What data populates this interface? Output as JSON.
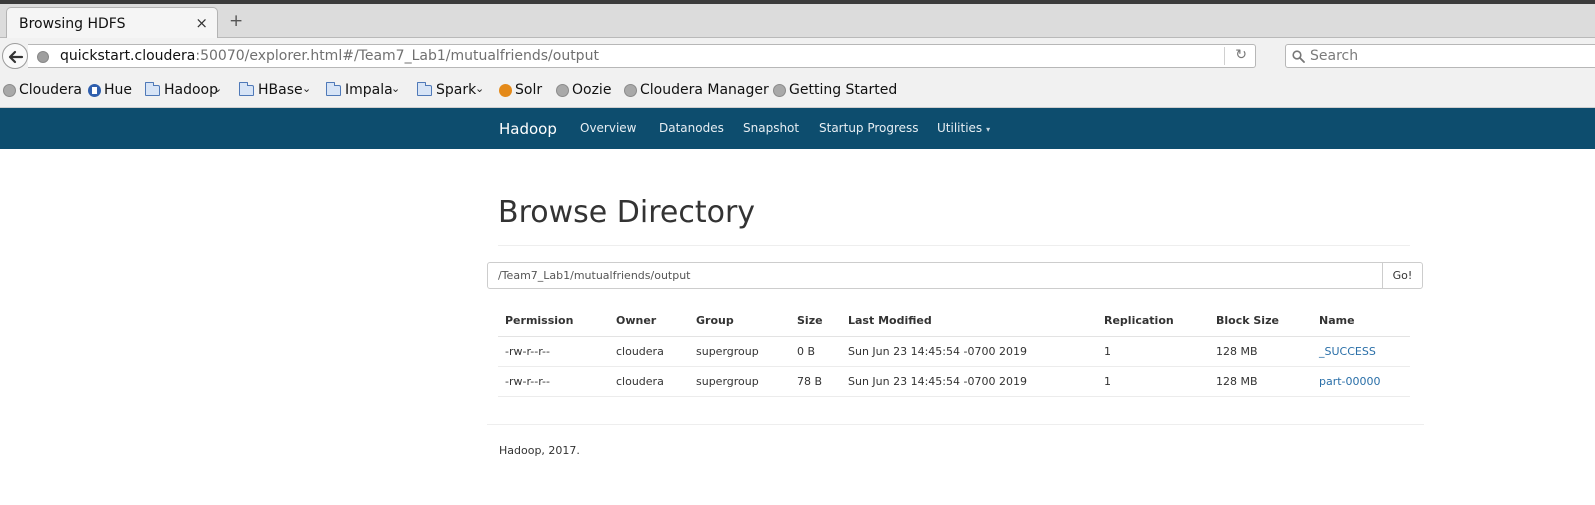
{
  "browser": {
    "tab_title": "Browsing HDFS",
    "tab_close": "×",
    "new_tab": "+",
    "url_host": "quickstart.cloudera",
    "url_rest": ":50070/explorer.html#/Team7_Lab1/mutualfriends/output",
    "search_placeholder": "Search",
    "bookmarks": [
      {
        "label": "Cloudera",
        "icon": "globe-icon",
        "menu": false
      },
      {
        "label": "Hue",
        "icon": "hue-icon",
        "menu": false
      },
      {
        "label": "Hadoop",
        "icon": "folder-icon",
        "menu": true
      },
      {
        "label": "HBase",
        "icon": "folder-icon",
        "menu": true
      },
      {
        "label": "Impala",
        "icon": "folder-icon",
        "menu": true
      },
      {
        "label": "Spark",
        "icon": "folder-icon",
        "menu": true
      },
      {
        "label": "Solr",
        "icon": "solr-icon",
        "menu": false
      },
      {
        "label": "Oozie",
        "icon": "globe-icon",
        "menu": false
      },
      {
        "label": "Cloudera Manager",
        "icon": "globe-icon",
        "menu": false
      },
      {
        "label": "Getting Started",
        "icon": "globe-icon",
        "menu": false
      }
    ],
    "menu_caret": "⌄"
  },
  "nav": {
    "brand": "Hadoop",
    "items": [
      "Overview",
      "Datanodes",
      "Snapshot",
      "Startup Progress",
      "Utilities"
    ],
    "dropdown_caret": "▾"
  },
  "page": {
    "title": "Browse Directory",
    "path_value": "/Team7_Lab1/mutualfriends/output",
    "go_label": "Go!"
  },
  "table": {
    "headers": [
      "Permission",
      "Owner",
      "Group",
      "Size",
      "Last Modified",
      "Replication",
      "Block Size",
      "Name"
    ],
    "rows": [
      {
        "permission": "-rw-r--r--",
        "owner": "cloudera",
        "group": "supergroup",
        "size": "0 B",
        "modified": "Sun Jun 23 14:45:54 -0700 2019",
        "replication": "1",
        "block_size": "128 MB",
        "name": "_SUCCESS"
      },
      {
        "permission": "-rw-r--r--",
        "owner": "cloudera",
        "group": "supergroup",
        "size": "78 B",
        "modified": "Sun Jun 23 14:45:54 -0700 2019",
        "replication": "1",
        "block_size": "128 MB",
        "name": "part-00000"
      }
    ]
  },
  "footer": {
    "text": "Hadoop, 2017."
  },
  "colors": {
    "nav_bg": "#0d4d6e",
    "link": "#2a6fa8"
  }
}
